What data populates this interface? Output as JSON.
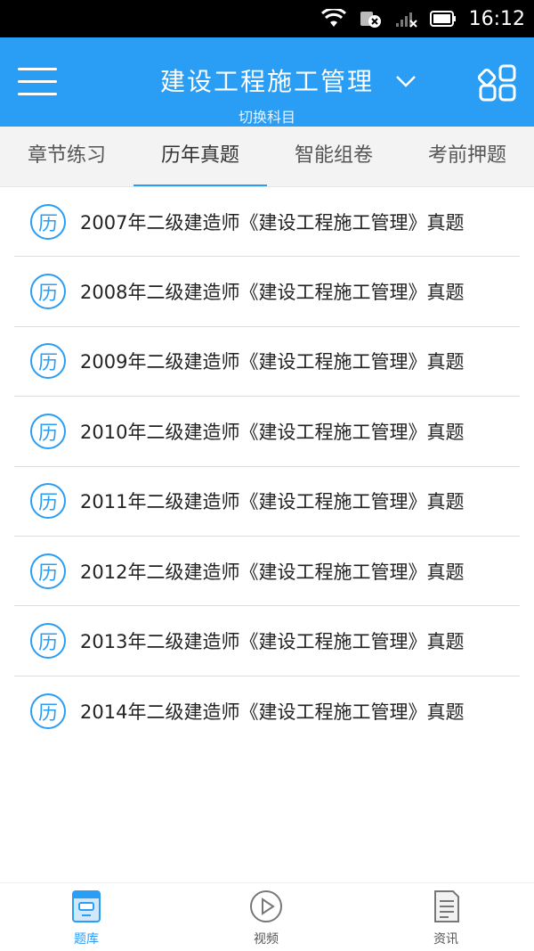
{
  "status_bar": {
    "time": "16:12"
  },
  "header": {
    "title": "建设工程施工管理",
    "subtitle": "切换科目",
    "accent": "#2a9df4"
  },
  "tabs": [
    {
      "label": "章节练习",
      "active": false
    },
    {
      "label": "历年真题",
      "active": true
    },
    {
      "label": "智能组卷",
      "active": false
    },
    {
      "label": "考前押题",
      "active": false
    }
  ],
  "list": {
    "badge": "历",
    "items": [
      "2007年二级建造师《建设工程施工管理》真题",
      "2008年二级建造师《建设工程施工管理》真题",
      "2009年二级建造师《建设工程施工管理》真题",
      "2010年二级建造师《建设工程施工管理》真题",
      "2011年二级建造师《建设工程施工管理》真题",
      "2012年二级建造师《建设工程施工管理》真题",
      "2013年二级建造师《建设工程施工管理》真题",
      "2014年二级建造师《建设工程施工管理》真题"
    ]
  },
  "bottom_nav": [
    {
      "label": "题库",
      "icon": "question-bank-icon",
      "active": true
    },
    {
      "label": "视频",
      "icon": "play-circle-icon",
      "active": false
    },
    {
      "label": "资讯",
      "icon": "document-icon",
      "active": false
    }
  ]
}
